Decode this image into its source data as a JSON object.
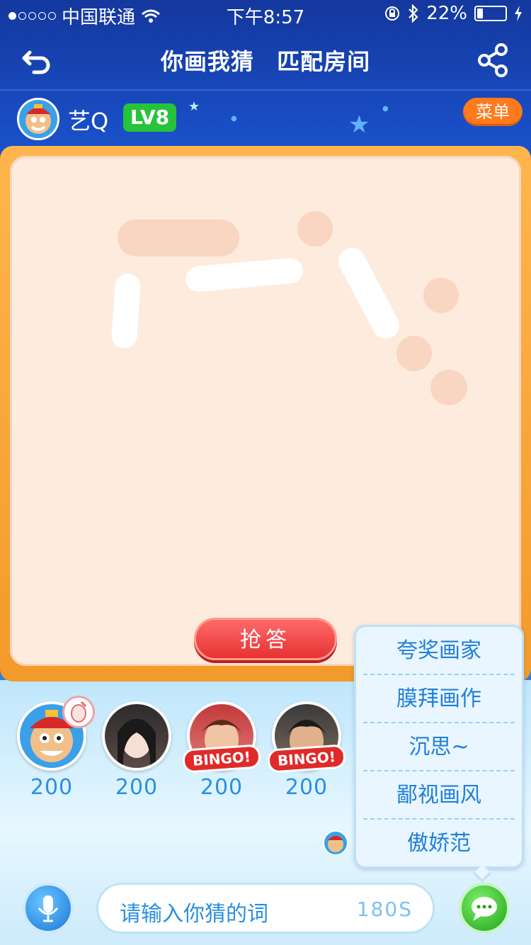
{
  "status_bar": {
    "carrier": "中国联通",
    "time": "下午8:57",
    "battery": "22%",
    "battery_level": 0.22
  },
  "nav": {
    "title": "你画我猜",
    "subtitle": "匹配房间",
    "back_icon": "back-arrow-icon",
    "share_icon": "share-icon"
  },
  "user": {
    "name": "艺Q",
    "level_prefix": "LV",
    "level": "8",
    "menu_label": "菜单"
  },
  "board": {
    "grab_button": "抢答"
  },
  "players": [
    {
      "score": "200",
      "badge": "painting"
    },
    {
      "score": "200"
    },
    {
      "score": "200",
      "bingo": "BINGO!"
    },
    {
      "score": "200",
      "bingo": "BINGO!"
    }
  ],
  "quick_menu": {
    "items": [
      "夸奖画家",
      "膜拜画作",
      "沉思~",
      "鄙视画风",
      "傲娇范"
    ]
  },
  "input": {
    "placeholder": "请输入你猜的词",
    "timer": "180S"
  },
  "colors": {
    "accent": "#1a50c8",
    "level_badge": "#27c33b",
    "menu_button": "#ff7a1c",
    "grab_button": "#e63232",
    "board_frame": "#f39a2a"
  }
}
